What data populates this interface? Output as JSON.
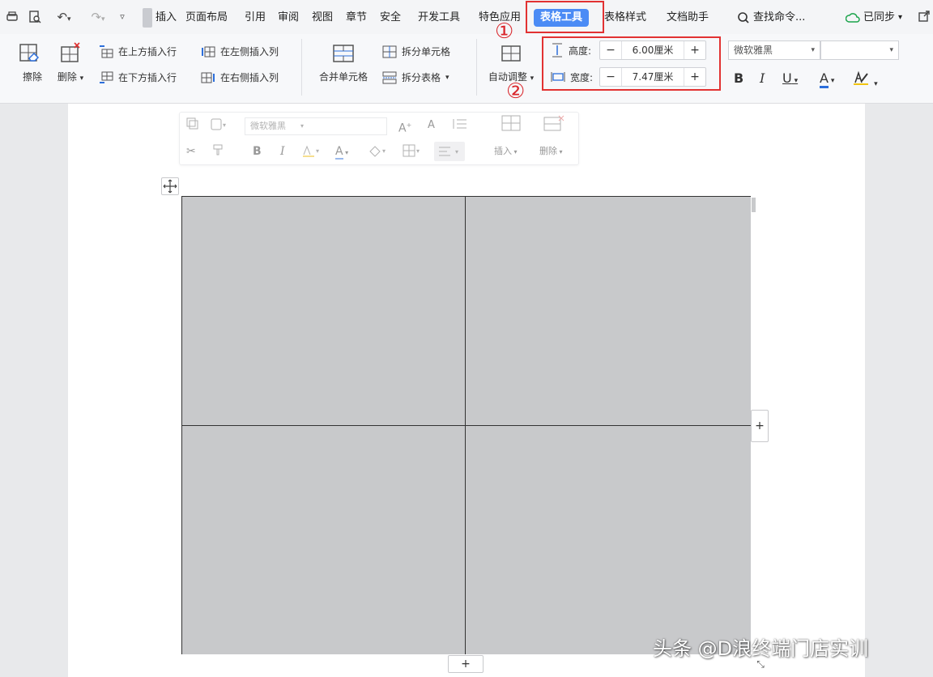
{
  "menubar": {
    "tabs": [
      "插入",
      "页面布局",
      "引用",
      "审阅",
      "视图",
      "章节",
      "安全",
      "开发工具",
      "特色应用",
      "表格工具",
      "表格样式",
      "文档助手"
    ],
    "active_tab": "表格工具",
    "search_label": "查找命令...",
    "sync_label": "已同步"
  },
  "ribbon": {
    "eraser": "擦除",
    "delete": "删除",
    "insert_above": "在上方插入行",
    "insert_below": "在下方插入行",
    "insert_left": "在左侧插入列",
    "insert_right": "在右侧插入列",
    "merge_cells": "合并单元格",
    "split_cells": "拆分单元格",
    "split_table": "拆分表格",
    "autofit": "自动调整",
    "height_label": "高度:",
    "height_value": "6.00厘米",
    "width_label": "宽度:",
    "width_value": "7.47厘米",
    "font_name": "微软雅黑",
    "font_size": ""
  },
  "annotations": {
    "one": "①",
    "two": "②"
  },
  "mini_toolbar": {
    "font_name": "微软雅黑",
    "insert": "插入",
    "delete": "删除"
  },
  "table": {
    "rows": 2,
    "cols": 2,
    "fill": "#c8c9cb"
  },
  "accent_color": "#4b8bf5",
  "highlight_color": "#e23232",
  "watermark": "头条 @D浪终端门店实训"
}
